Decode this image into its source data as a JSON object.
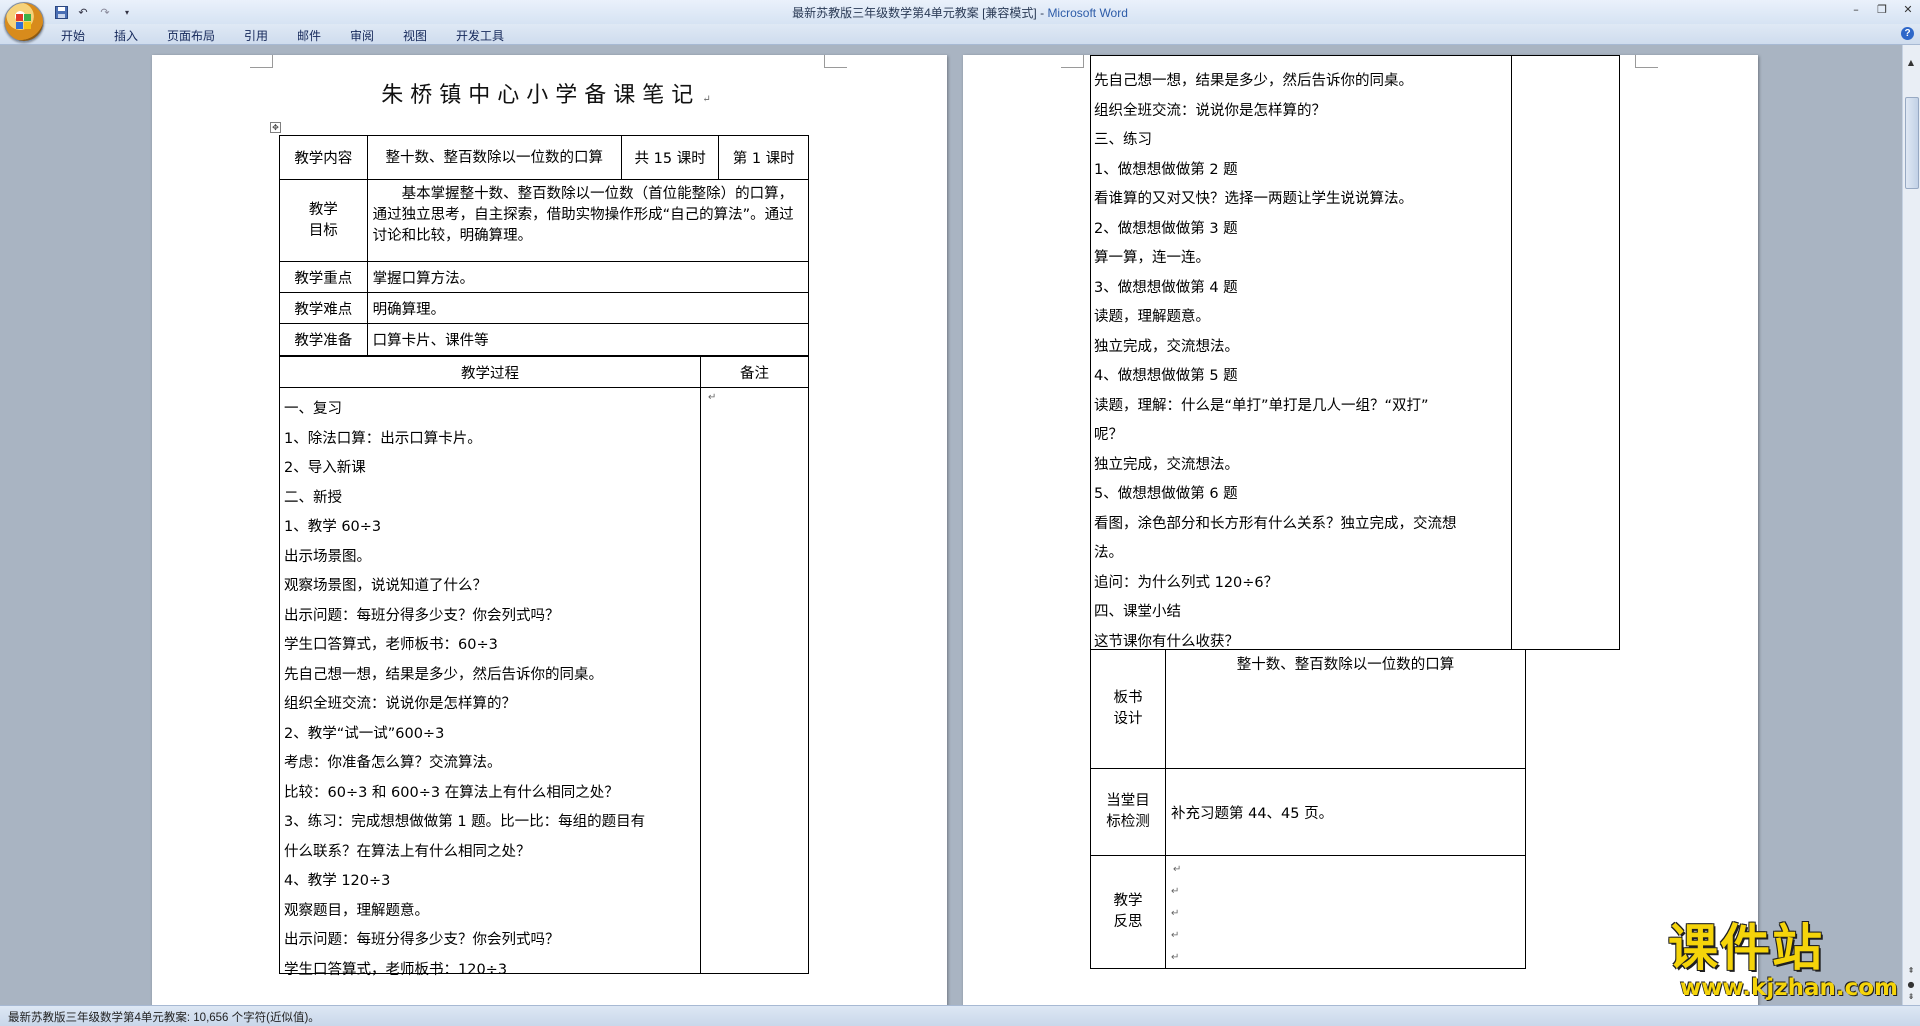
{
  "window": {
    "title": "最新苏教版三年级数学第4单元教案 [兼容模式] - ",
    "app_name": "Microsoft Word",
    "icons": [
      "office-button-icon",
      "save-icon",
      "undo-icon",
      "redo-icon",
      "customize-icon",
      "minimize-icon",
      "restore-icon",
      "close-icon",
      "help-icon"
    ]
  },
  "ribbon": {
    "tabs": [
      "开始",
      "插入",
      "页面布局",
      "引用",
      "邮件",
      "审阅",
      "视图",
      "开发工具"
    ]
  },
  "left_page": {
    "title": "朱桥镇中心小学备课笔记",
    "table": {
      "content_label": "教学内容",
      "content_value": "整十数、整百数除以一位数的口算",
      "total_hours": "共 15 课时",
      "lesson_no": "第 1 课时",
      "goal_label_1": "教学",
      "goal_label_2": "目标",
      "goal_text": "基本掌握整十数、整百数除以一位数（首位能整除）的口算，通过独立思考，自主探索，借助实物操作形成“自己的算法”。通过讨论和比较，明确算理。",
      "key_label": "教学重点",
      "key_value": "掌握口算方法。",
      "diff_label": "教学难点",
      "diff_value": "明确算理。",
      "prep_label": "教学准备",
      "prep_value": "口算卡片、课件等",
      "process_header": "教学过程",
      "notes_header": "备注"
    },
    "process_lines": [
      "一、复习",
      "1、除法口算：出示口算卡片。",
      "2、导入新课",
      "二、新授",
      "1、教学 60÷3",
      "   出示场景图。",
      "观察场景图，说说知道了什么？",
      "出示问题：每班分得多少支？你会列式吗？",
      "学生口答算式，老师板书：60÷3",
      "先自己想一想，结果是多少，然后告诉你的同桌。",
      "组织全班交流：说说你是怎样算的？",
      "2、教学“试一试”600÷3",
      "  考虑：你准备怎么算？交流算法。",
      "比较：60÷3  和 600÷3  在算法上有什么相同之处？",
      " 3、练习：完成想想做做第 1 题。比一比：每组的题目有",
      "什么联系？在算法上有什么相同之处？",
      "4、教学 120÷3",
      "     观察题目，理解题意。",
      "出示问题：每班分得多少支？你会列式吗？",
      "学生口答算式，老师板书：120÷3"
    ]
  },
  "right_page": {
    "process_lines": [
      "先自己想一想，结果是多少，然后告诉你的同桌。",
      "组织全班交流：说说你是怎样算的？",
      "三、练习",
      "1、做想想做做第 2 题",
      "看谁算的又对又快？选择一两题让学生说说算法。",
      "2、做想想做做第 3 题",
      "  算一算，连一连。",
      "3、做想想做做第 4 题",
      "  读题，理解题意。",
      "独立完成，交流想法。",
      "4、做想想做做第 5 题",
      "读题，理解：什么是“单打”单打是几人一组？“双打”",
      "呢？",
      "独立完成，交流想法。",
      "5、做想想做做第 6 题",
      "看图，涂色部分和长方形有什么关系？独立完成，交流想",
      "法。",
      "追问：为什么列式 120÷6？",
      "四、课堂小结",
      "这节课你有什么收获？"
    ],
    "board_label_1": "板书",
    "board_label_2": "设计",
    "board_title": "整十数、整百数除以一位数的口算",
    "check_label_1": "当堂目",
    "check_label_2": "标检测",
    "check_value": "补充习题第 44、45 页。",
    "reflect_label_1": "教学",
    "reflect_label_2": "反思"
  },
  "status": {
    "text": "最新苏教版三年级数学第4单元教案: 10,656 个字符(近似值)。"
  },
  "watermark": {
    "main": "课件站",
    "url": "www.kjzhan.com"
  }
}
